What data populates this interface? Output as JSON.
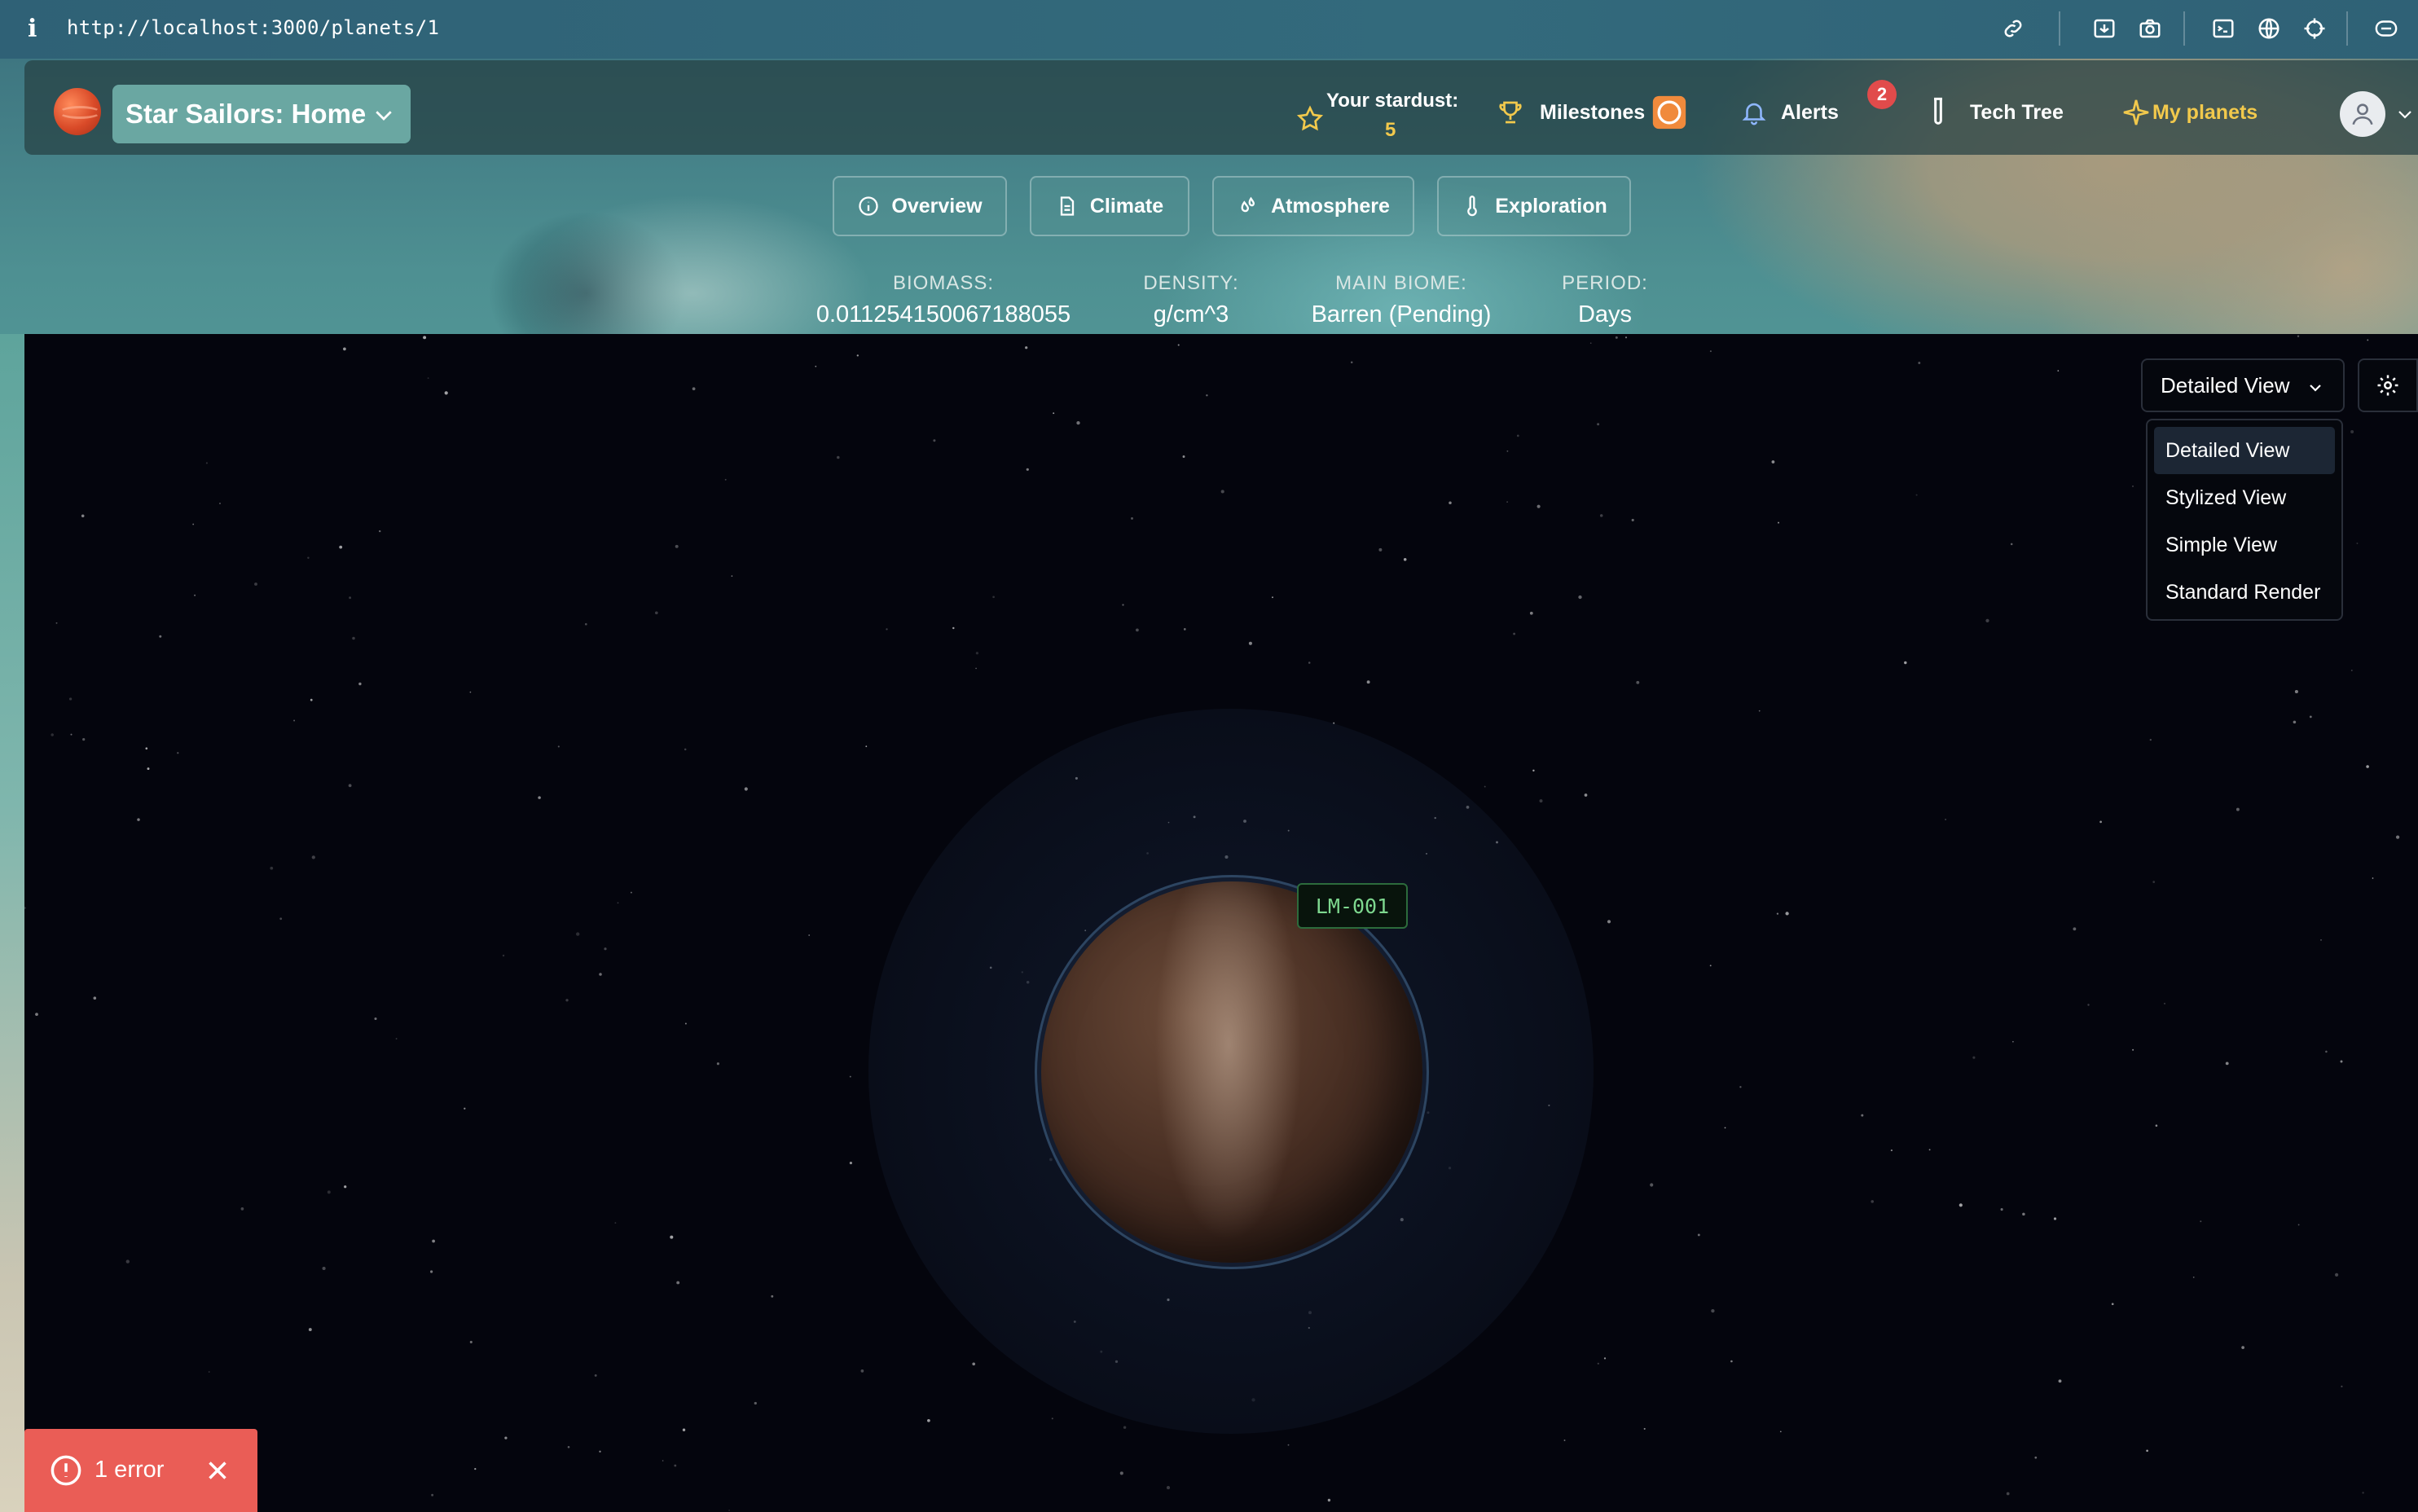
{
  "browser": {
    "url": "http://localhost:3000/planets/1",
    "info_icon": "i"
  },
  "navbar": {
    "home_label": "Star Sailors: Home",
    "stardust_label": "Your stardust:",
    "stardust_value": "5",
    "milestones_label": "Milestones",
    "alerts_label": "Alerts",
    "alerts_count": "2",
    "techtree_label": "Tech Tree",
    "myplanets_label": "My planets"
  },
  "tabs": [
    {
      "label": "Overview",
      "icon": "info-circle-icon"
    },
    {
      "label": "Climate",
      "icon": "document-icon"
    },
    {
      "label": "Atmosphere",
      "icon": "droplets-icon"
    },
    {
      "label": "Exploration",
      "icon": "thermometer-icon"
    }
  ],
  "stats": [
    {
      "key": "BIOMASS:",
      "value": "0.011254150067188055"
    },
    {
      "key": "DENSITY:",
      "value": "g/cm^3"
    },
    {
      "key": "MAIN BIOME:",
      "value": "Barren (Pending)"
    },
    {
      "key": "PERIOD:",
      "value": "Days"
    }
  ],
  "viewer": {
    "selected_view": "Detailed View",
    "view_options": [
      "Detailed View",
      "Stylized View",
      "Simple View",
      "Standard Render"
    ],
    "planet_label": "LM-001"
  },
  "error_toast": {
    "text": "1 error"
  },
  "colors": {
    "accent_gold": "#f2c94c",
    "home_button": "#6aa7a2",
    "error": "#ea5d56",
    "badge": "#e14b4b",
    "space": "#04050d"
  }
}
